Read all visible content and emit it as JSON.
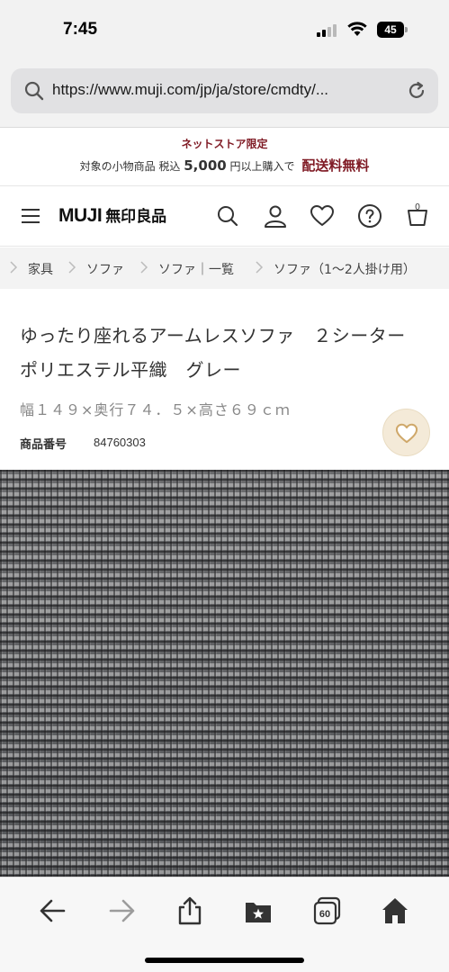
{
  "status": {
    "time": "7:45",
    "battery": "45"
  },
  "browser": {
    "url": "https://www.muji.com/jp/ja/store/cmdty/..."
  },
  "promo": {
    "line1": "ネットストア限定",
    "line2_prefix": "対象の小物商品 税込",
    "line2_amount": "5,000",
    "line2_suffix": "円以上購入で",
    "line2_free": "配送料無料"
  },
  "header": {
    "logo_main": "MUJI",
    "logo_sub": "無印良品",
    "cart_count": "0"
  },
  "breadcrumb": [
    "家具",
    "ソファ",
    "ソファ｜一覧",
    "ソファ（1〜2人掛け用）"
  ],
  "product": {
    "title": "ゆったり座れるアームレスソファ　２シーター　ポリエステル平織　グレー",
    "dimensions": "幅１４９×奥行７４．５×高さ６９ｃｍ",
    "code_label": "商品番号",
    "code_value": "84760303"
  },
  "toolbar": {
    "tabs_count": "60"
  },
  "colors": {
    "accent": "#7f1a24",
    "fav_bg": "#f4ead8",
    "fav_icon": "#cfa86a"
  },
  "icons": [
    "search-icon",
    "reload-icon",
    "menu-icon",
    "user-icon",
    "heart-icon",
    "help-icon",
    "cart-icon",
    "back-icon",
    "forward-icon",
    "share-icon",
    "bookmarks-icon",
    "tabs-icon",
    "home-icon"
  ]
}
